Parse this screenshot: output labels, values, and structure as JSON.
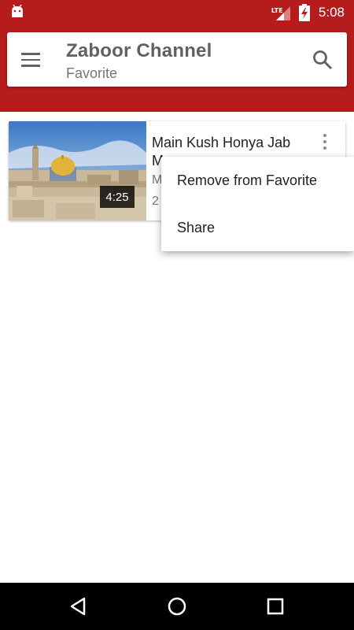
{
  "status_bar": {
    "network": "LTE",
    "time": "5:08",
    "icons": [
      "android-icon",
      "signal-lte-icon",
      "battery-charging-icon"
    ]
  },
  "header": {
    "title": "Zaboor Channel",
    "subtitle": "Favorite",
    "menu_icon": "hamburger-menu-icon",
    "search_icon": "search-icon"
  },
  "videos": [
    {
      "title": "Main Kush Honya Jab Mere",
      "duration": "4:25",
      "meta_line1": "M",
      "meta_line2": "2",
      "more_icon": "more-vert-icon"
    }
  ],
  "popup_menu": {
    "items": [
      {
        "label": "Remove from Favorite"
      },
      {
        "label": "Share"
      }
    ]
  },
  "navigation": {
    "buttons": [
      "back-icon",
      "home-icon",
      "recents-icon"
    ]
  },
  "colors": {
    "primary": "#b71c1c",
    "nav_bar": "#000000"
  }
}
